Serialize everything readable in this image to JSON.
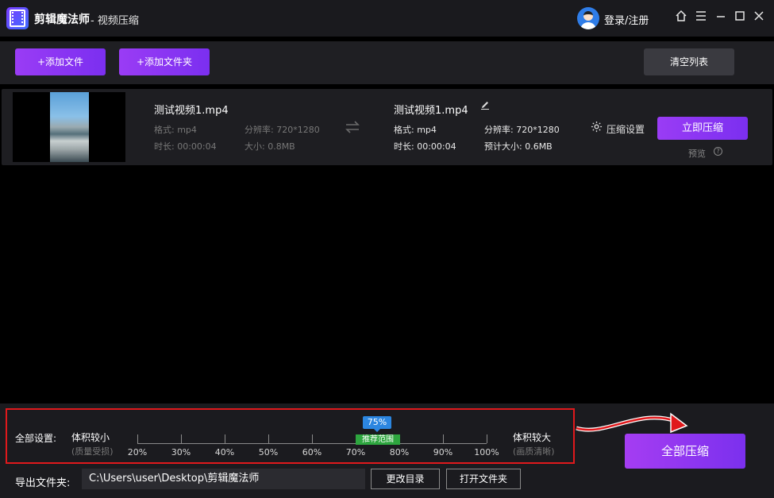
{
  "app": {
    "name": "剪辑魔法师",
    "subtitle": "- 视频压缩",
    "login": "登录/注册"
  },
  "window_icons": [
    "home-icon",
    "menu-icon",
    "minimize-icon",
    "maximize-icon",
    "close-icon"
  ],
  "toolbar": {
    "add_file": "+添加文件",
    "add_folder": "+添加文件夹",
    "clear_list": "清空列表"
  },
  "file": {
    "source": {
      "name": "测试视频1.mp4",
      "format": "格式: mp4",
      "resolution": "分辨率: 720*1280",
      "duration": "时长: 00:00:04",
      "size": "大小: 0.8MB"
    },
    "output": {
      "name": "测试视频1.mp4",
      "format": "格式: mp4",
      "resolution": "分辨率: 720*1280",
      "duration": "时长: 00:00:04",
      "size": "预计大小: 0.6MB"
    },
    "compress_settings": "压缩设置",
    "compress_now": "立即压缩",
    "preview": "预览",
    "help": "?"
  },
  "global": {
    "label": "全部设置:",
    "small": "体积较小",
    "small_sub": "(质量受损)",
    "large": "体积较大",
    "large_sub": "(画质清晰)",
    "ticks": [
      "20%",
      "30%",
      "40%",
      "50%",
      "60%",
      "70%",
      "80%",
      "90%",
      "100%"
    ],
    "recommend": "推荐范围",
    "value_label": "75%",
    "value": 75,
    "compress_all": "全部压缩"
  },
  "export": {
    "label": "导出文件夹:",
    "path": "C:\\Users\\user\\Desktop\\剪辑魔法师",
    "change_dir": "更改目录",
    "open_folder": "打开文件夹"
  },
  "colors": {
    "accent": "#8b36f3",
    "highlight": "#e0191c",
    "recommend": "#2ea63f",
    "value_badge": "#2c86e0"
  }
}
